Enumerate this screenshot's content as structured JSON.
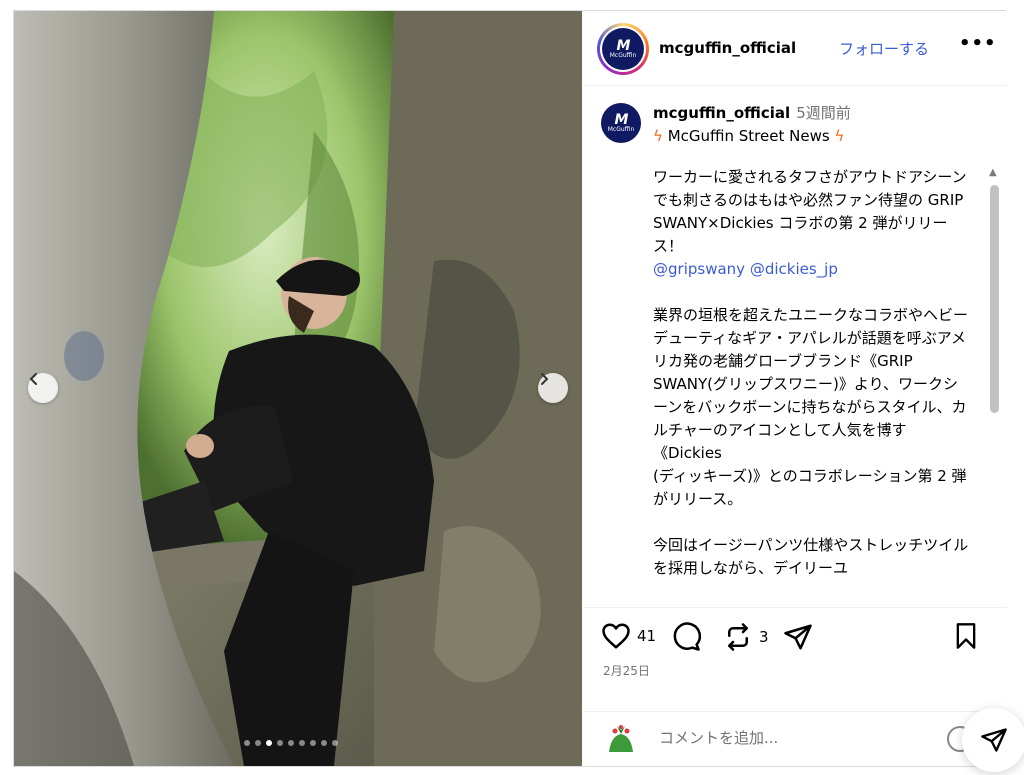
{
  "post": {
    "username": "mcguffin_official",
    "follow_label": "フォローする",
    "more_label": "•••",
    "avatar_logo": {
      "mark": "M",
      "text": "McGuffin"
    }
  },
  "caption": {
    "username": "mcguffin_official",
    "time_ago": "5週間前",
    "title": "McGuffin Street News",
    "paragraph1": "ワーカーに愛されるタフさがアウトドアシーンでも刺さるのはもはや必然ファン待望の GRIP SWANY×Dickies コラボの第 2 弾がリリース！",
    "mention1": "@gripswany",
    "mention2": "@dickies_jp",
    "paragraph2": "業界の垣根を超えたユニークなコラボやヘビーデューティなギア・アパレルが話題を呼ぶアメリカ発の老舗グローブブランド《GRIP SWANY(グリップスワニー)》より、ワークシーンをバックボーンに持ちながらスタイル、カルチャーのアイコンとして人気を博す《Dickies\n(ディッキーズ)》とのコラボレーション第 2 弾がリリース。",
    "paragraph3": "今回はイージーパンツ仕様やストレッチツイルを採用しながら、デイリーユ"
  },
  "actions": {
    "likes": "41",
    "reposts": "3",
    "date": "2月25日"
  },
  "comment": {
    "placeholder": "コメントを追加..."
  },
  "carousel": {
    "slide_count": 9,
    "active_index": 2
  },
  "colors": {
    "follow": "#3a5ad8",
    "mention": "#3b5bd6",
    "logo_bg": "#0f1a63",
    "bolt": "#f26b1d"
  },
  "icons": [
    "chevron-left-icon",
    "chevron-right-icon",
    "heart-icon",
    "comment-icon",
    "repost-icon",
    "share-icon",
    "bookmark-icon",
    "emoji-icon",
    "send-icon"
  ]
}
